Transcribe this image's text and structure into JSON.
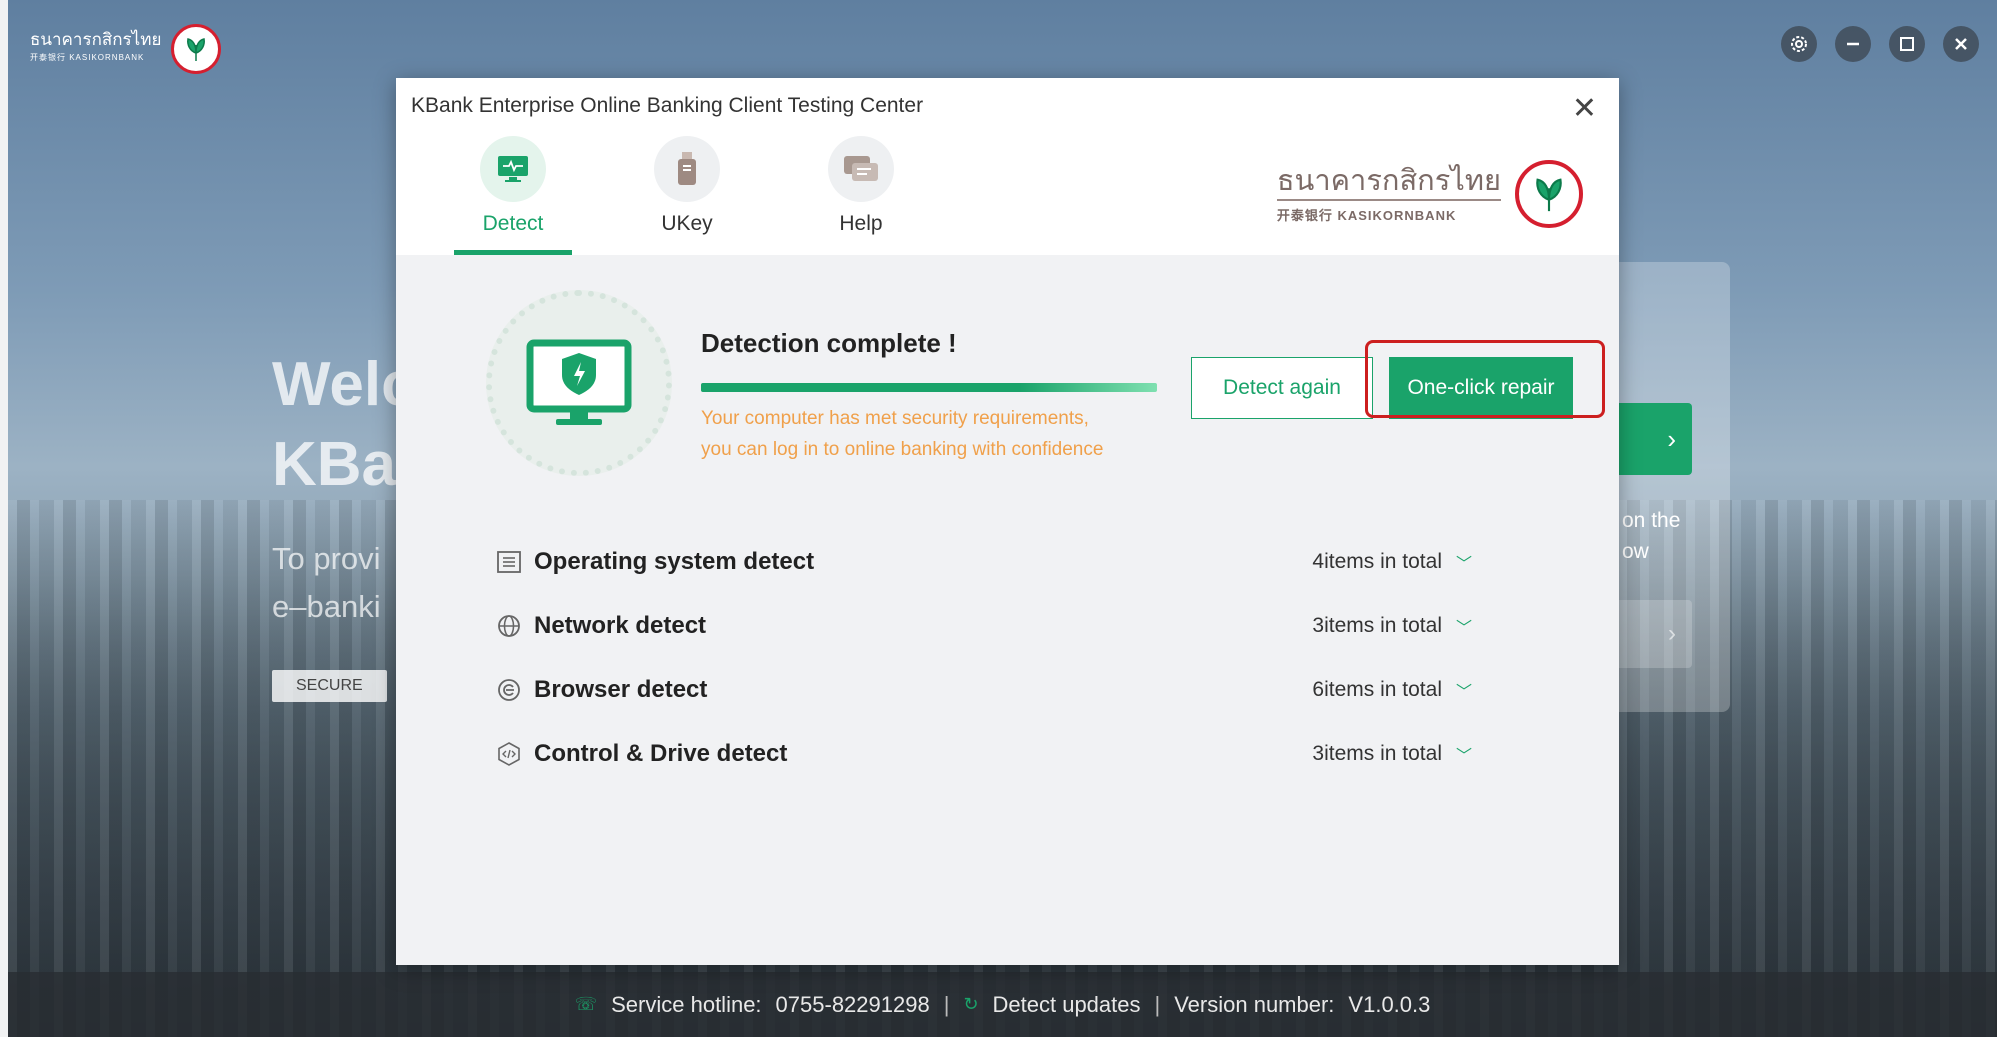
{
  "background_app": {
    "logo_thai": "ธนาคารกสิกรไทย",
    "logo_en": "开泰银行 KASIKORNBANK",
    "welcome_line1": "Welc",
    "welcome_line2": "KBa",
    "sub_line1": "To provi",
    "sub_line2": "e–banki",
    "secure_label": "SECURE",
    "panel_text_line1": "on the",
    "panel_text_line2": "ow",
    "window_controls": [
      "settings-icon",
      "minimize-icon",
      "maximize-icon",
      "close-icon"
    ]
  },
  "footer": {
    "hotline_label": "Service hotline:",
    "hotline_number": "0755-82291298",
    "detect_updates": "Detect updates",
    "version_label": "Version number:",
    "version_value": "V1.0.0.3"
  },
  "dialog": {
    "title": "KBank Enterprise Online Banking Client Testing Center",
    "close_glyph": "✕",
    "tabs": [
      {
        "label": "Detect",
        "icon": "monitor-icon",
        "active": true
      },
      {
        "label": "UKey",
        "icon": "usb-key-icon",
        "active": false
      },
      {
        "label": "Help",
        "icon": "chat-icon",
        "active": false
      }
    ],
    "brand_thai": "ธนาคารกสิกรไทย",
    "brand_en": "开泰银行 KASIKORNBANK",
    "status": {
      "title": "Detection complete !",
      "progress_percent": 100,
      "message_line1": "Your computer has met security requirements,",
      "message_line2": "you can log in to online banking with confidence"
    },
    "buttons": {
      "detect_again": "Detect again",
      "one_click_repair": "One-click repair"
    },
    "detect_items": [
      {
        "label": "Operating system detect",
        "count": "4items in total",
        "icon": "list-icon"
      },
      {
        "label": "Network detect",
        "count": "3items in total",
        "icon": "globe-icon"
      },
      {
        "label": "Browser detect",
        "count": "6items in total",
        "icon": "browser-icon"
      },
      {
        "label": "Control & Drive detect",
        "count": "3items in total",
        "icon": "code-icon"
      }
    ]
  },
  "colors": {
    "accent": "#1aa36a",
    "warning_text": "#f0a04a",
    "highlight": "#cc1f1f",
    "brand_red": "#d51f2f"
  }
}
